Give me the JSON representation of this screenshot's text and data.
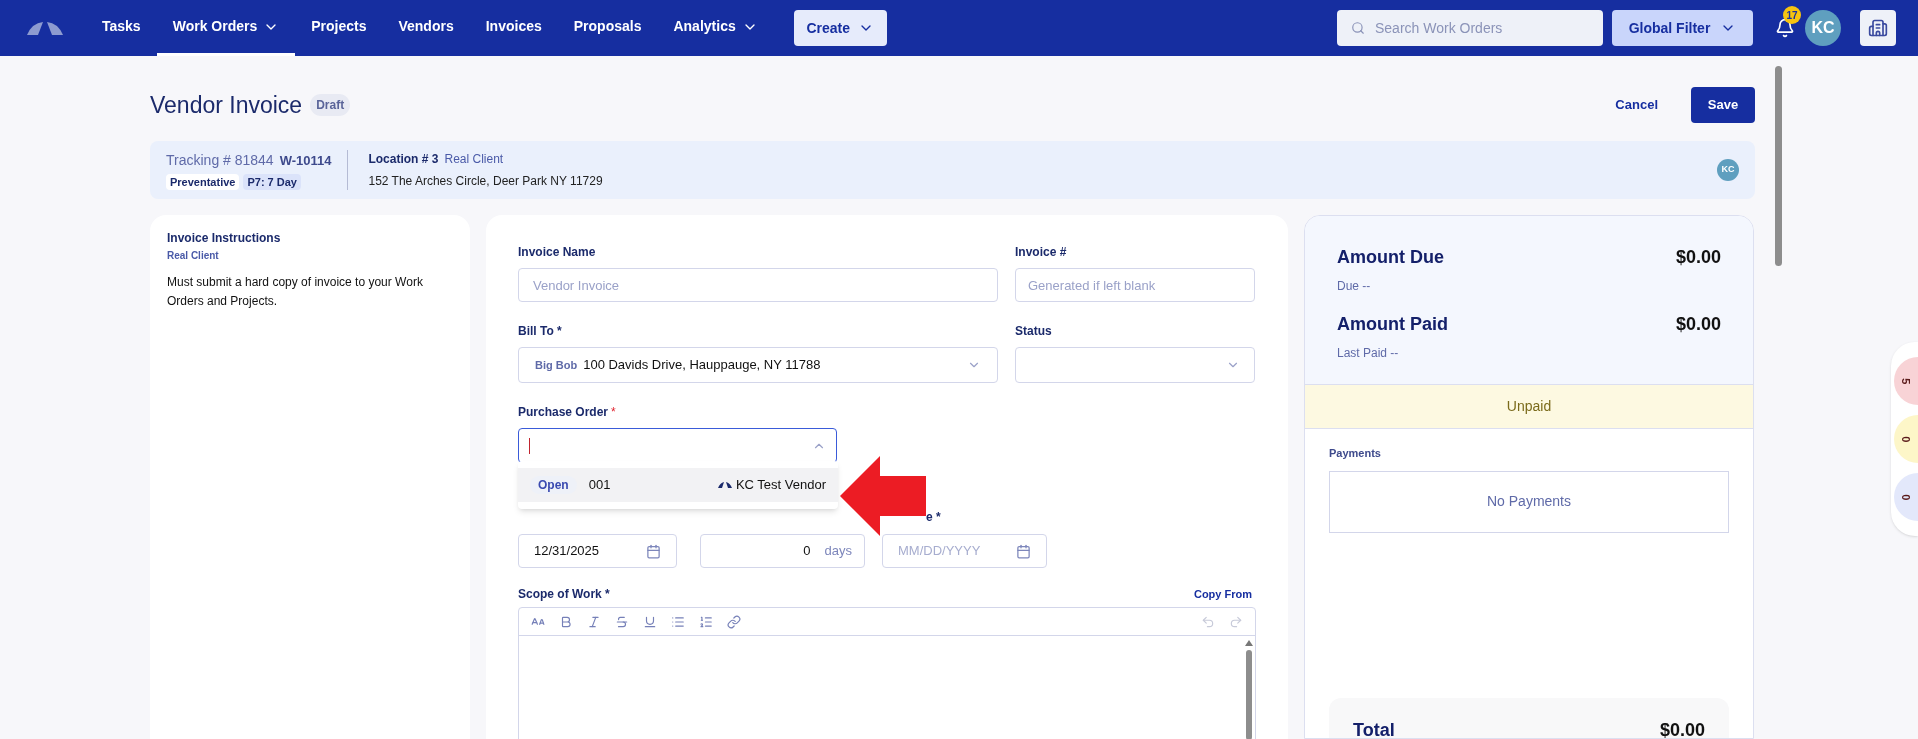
{
  "nav": {
    "items": [
      {
        "label": "Tasks",
        "selected": false,
        "dropdown": false
      },
      {
        "label": "Work Orders",
        "selected": true,
        "dropdown": true
      },
      {
        "label": "Projects",
        "selected": false,
        "dropdown": false
      },
      {
        "label": "Vendors",
        "selected": false,
        "dropdown": false
      },
      {
        "label": "Invoices",
        "selected": false,
        "dropdown": false
      },
      {
        "label": "Proposals",
        "selected": false,
        "dropdown": false
      },
      {
        "label": "Analytics",
        "selected": false,
        "dropdown": true
      }
    ],
    "create": "Create",
    "search": {
      "placeholder": "Search Work Orders"
    },
    "global_filter": "Global Filter",
    "notification_count": "17",
    "avatar": "KC"
  },
  "header": {
    "title": "Vendor Invoice",
    "status": "Draft",
    "cancel": "Cancel",
    "save": "Save"
  },
  "info_bar": {
    "tracking": "Tracking # 81844",
    "work_order": "W-10114",
    "tags": [
      "Preventative",
      "P7: 7 Day"
    ],
    "location": "Location # 3",
    "client": "Real Client",
    "address": "152 The Arches Circle, Deer Park NY 11729",
    "avatar": "KC"
  },
  "instructions": {
    "title": "Invoice Instructions",
    "client": "Real Client",
    "text": "Must submit a hard copy of invoice to your Work Orders and Projects."
  },
  "form": {
    "invoice_name": {
      "label": "Invoice Name",
      "placeholder": "Vendor Invoice"
    },
    "invoice_number": {
      "label": "Invoice #",
      "placeholder": "Generated if left blank"
    },
    "bill_to": {
      "label": "Bill To *",
      "name": "Big Bob",
      "value": "100 Davids Drive, Hauppauge, NY 11788"
    },
    "status": {
      "label": "Status"
    },
    "purchase_order": {
      "label": "Purchase Order",
      "required_mark": "*",
      "focused": true,
      "options": [
        {
          "status": "Open",
          "number": "001",
          "vendor": "KC Test Vendor",
          "selected": true
        }
      ]
    },
    "dates": {
      "date": "12/31/2025",
      "days_value": "0",
      "days_unit": "days",
      "due_label": "e *",
      "due_placeholder": "MM/DD/YYYY"
    },
    "scope": {
      "label": "Scope of Work *",
      "copy_from": "Copy From",
      "toolbar": [
        {
          "kind": "text-size",
          "disabled": false
        },
        {
          "kind": "bold",
          "disabled": false
        },
        {
          "kind": "italic",
          "disabled": false
        },
        {
          "kind": "strikethrough",
          "disabled": false
        },
        {
          "kind": "underline",
          "disabled": false
        },
        {
          "kind": "bullet-list",
          "disabled": false
        },
        {
          "kind": "numbered-list",
          "disabled": false
        },
        {
          "kind": "link",
          "disabled": false
        },
        {
          "kind": "undo",
          "disabled": true
        },
        {
          "kind": "redo",
          "disabled": true
        }
      ]
    }
  },
  "summary": {
    "amount_due_label": "Amount Due",
    "amount_due": "$0.00",
    "due": "Due --",
    "amount_paid_label": "Amount Paid",
    "amount_paid": "$0.00",
    "last_paid": "Last Paid --",
    "status": "Unpaid",
    "payments_label": "Payments",
    "payments_empty": "No Payments",
    "total_label": "Total",
    "total": "$0.00"
  },
  "side_counters": [
    {
      "count": "5",
      "color": "#f8d3d6"
    },
    {
      "count": "0",
      "color": "#fdf6c8"
    },
    {
      "count": "0",
      "color": "#e3e8fb"
    }
  ]
}
